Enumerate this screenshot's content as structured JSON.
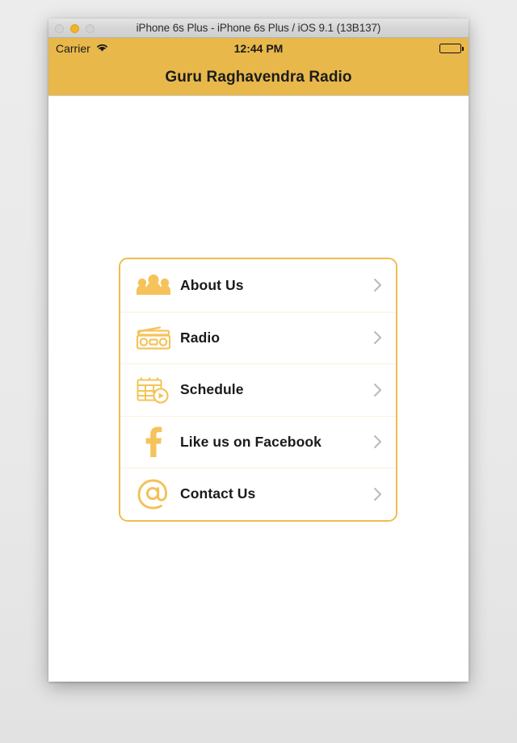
{
  "window": {
    "title": "iPhone 6s Plus - iPhone 6s Plus / iOS 9.1 (13B137)",
    "controls": {
      "close": "close-button",
      "minimize": "minimize-button",
      "zoom": "zoom-button"
    }
  },
  "status_bar": {
    "carrier": "Carrier",
    "wifi": "wifi-icon",
    "time": "12:44 PM",
    "battery": "battery-full-icon"
  },
  "nav_bar": {
    "title": "Guru Raghavendra Radio"
  },
  "menu": {
    "items": [
      {
        "label": "About Us",
        "icon": "people-group-icon",
        "chevron": "chevron-right-icon"
      },
      {
        "label": "Radio",
        "icon": "radio-boombox-icon",
        "chevron": "chevron-right-icon"
      },
      {
        "label": "Schedule",
        "icon": "calendar-clock-icon",
        "chevron": "chevron-right-icon"
      },
      {
        "label": "Like us on Facebook",
        "icon": "facebook-f-icon",
        "chevron": "chevron-right-icon"
      },
      {
        "label": "Contact Us",
        "icon": "at-sign-icon",
        "chevron": "chevron-right-icon"
      }
    ]
  },
  "colors": {
    "accent_bar": "#E8B84B",
    "icon_amber": "#F5C35A",
    "card_border": "#EFBD4D",
    "divider": "#FDF0DD",
    "text_dark": "#1A1A1A",
    "chevron_grey": "#B9B9B9"
  }
}
